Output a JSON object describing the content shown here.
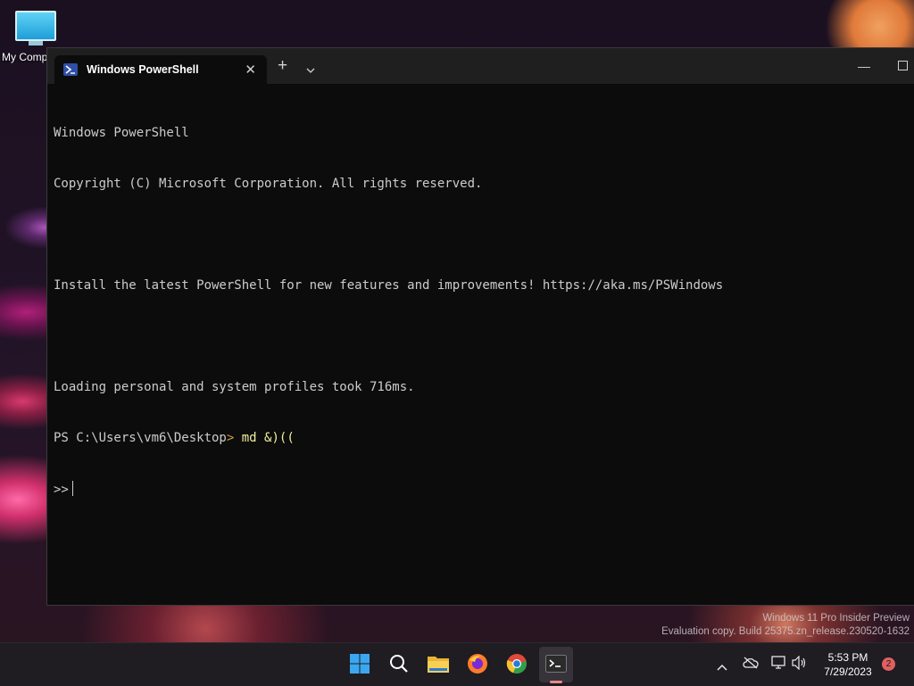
{
  "desktop": {
    "icon_label": "My Computer"
  },
  "window": {
    "tab_title": "Windows PowerShell",
    "tab_close": "✕",
    "new_tab": "+",
    "minimize": "—"
  },
  "console": {
    "lines": [
      "Windows PowerShell",
      "Copyright (C) Microsoft Corporation. All rights reserved.",
      "",
      "Install the latest PowerShell for new features and improvements! https://aka.ms/PSWindows",
      "",
      "Loading personal and system profiles took 716ms."
    ],
    "prompt_path": "PS C:\\Users\\vm6\\Desktop",
    "prompt_gt": ">",
    "command": " md &)((",
    "continuation": ">>"
  },
  "watermark": {
    "line1": "Windows 11 Pro Insider Preview",
    "line2": "Evaluation copy. Build 25375.zn_release.230520-1632"
  },
  "taskbar": {
    "time": "5:53 PM",
    "date": "7/29/2023",
    "notifications": "2",
    "icons": [
      "start-icon",
      "search-icon",
      "file-explorer-icon",
      "firefox-icon",
      "chrome-icon",
      "terminal-icon"
    ]
  },
  "colors": {
    "terminal_bg": "#0c0c0c",
    "titlebar_bg": "#1f1f1f",
    "console_text": "#cccccc",
    "command_text": "#f0f0a0",
    "prompt_gt": "#d29a40",
    "taskbar_bg": "#1f1c22"
  }
}
